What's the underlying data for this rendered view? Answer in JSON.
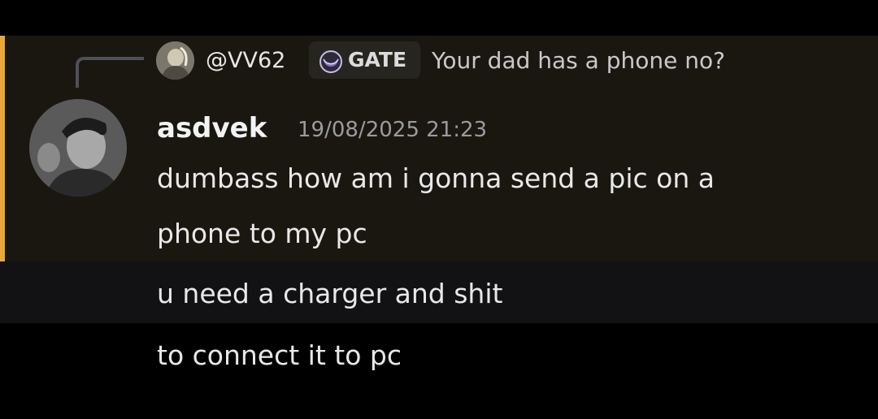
{
  "reply": {
    "author": "@VV62",
    "tag": "GATE",
    "text": "Your dad has a phone no?"
  },
  "message": {
    "username": "asdvek",
    "timestamp": "19/08/2025 21:23",
    "lines": [
      "dumbass how am i gonna send a pic on a",
      "phone to my pc"
    ]
  },
  "followups": [
    "u need a charger and shit",
    "to connect it to pc"
  ],
  "colors": {
    "mention_bar": "#e8a93a",
    "highlight_bg": "#1a1710",
    "tag_icon": "#8a6fc9"
  },
  "icons": {
    "tag": "crescent-moon-icon"
  }
}
